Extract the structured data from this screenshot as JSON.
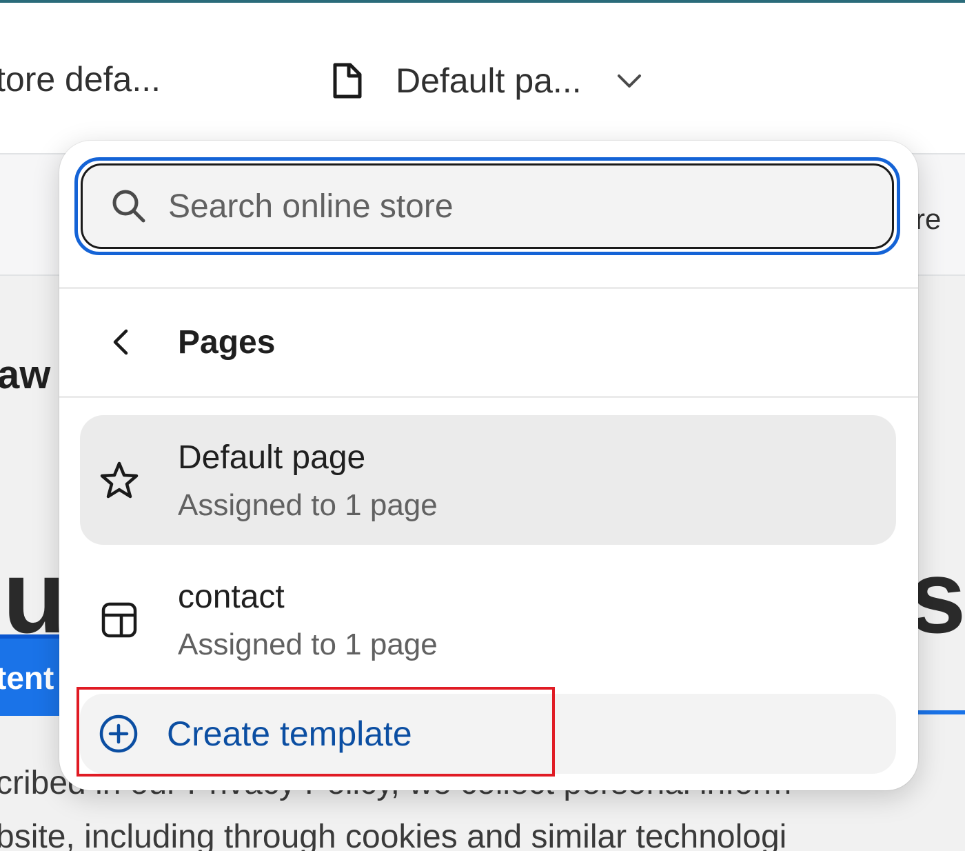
{
  "topbar": {
    "store_crumb": "tore defa...",
    "page_selector_label": "Default pa...",
    "file_icon": "file-icon",
    "chevron_icon": "chevron-down-icon"
  },
  "background": {
    "right_fragment": "re",
    "fragment_aw": "aw l",
    "fragment_u": "u",
    "fragment_s": "s",
    "tab_fragment": "tent",
    "body_line_1": "cribed in our Privacy Policy, we collect personal inform",
    "body_line_2": "bsite, including through cookies and similar technologi"
  },
  "popover": {
    "search": {
      "placeholder": "Search online store",
      "value": ""
    },
    "section": {
      "title": "Pages",
      "back_icon": "chevron-left-icon"
    },
    "items": [
      {
        "title": "Default page",
        "subtitle": "Assigned to 1 page",
        "icon": "star-icon",
        "selected": true
      },
      {
        "title": "contact",
        "subtitle": "Assigned to 1 page",
        "icon": "layout-template-icon",
        "selected": false
      }
    ],
    "create": {
      "label": "Create template",
      "icon": "plus-circle-icon"
    }
  },
  "colors": {
    "focus_ring": "#1463d6",
    "link": "#0b4ea2",
    "selected_bg": "#ebebeb",
    "highlight": "#e01b24"
  }
}
